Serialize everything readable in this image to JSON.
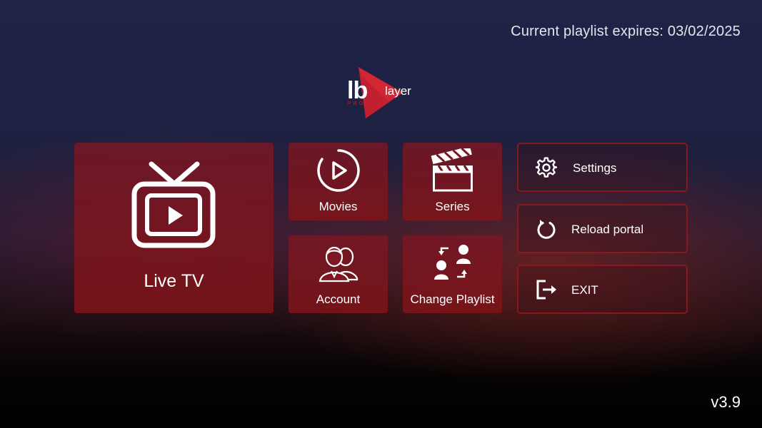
{
  "header": {
    "expires_text": "Current playlist expires: 03/02/2025"
  },
  "logo": {
    "main": "lb",
    "suffix": "layer",
    "badge": "PRO"
  },
  "tiles": {
    "live_tv": {
      "label": "Live TV",
      "icon": "tv-play-icon"
    },
    "movies": {
      "label": "Movies",
      "icon": "circle-play-icon"
    },
    "series": {
      "label": "Series",
      "icon": "clapperboard-icon"
    },
    "account": {
      "label": "Account",
      "icon": "users-icon"
    },
    "change_playlist": {
      "label": "Change Playlist",
      "icon": "swap-users-icon"
    }
  },
  "side_buttons": {
    "settings": {
      "label": "Settings",
      "icon": "gear-icon"
    },
    "reload": {
      "label": "Reload portal",
      "icon": "reload-icon"
    },
    "exit": {
      "label": "EXIT",
      "icon": "exit-icon"
    }
  },
  "footer": {
    "version": "v3.9"
  },
  "colors": {
    "accent_red": "#c21f2f",
    "tile_red": "#7f1624"
  }
}
